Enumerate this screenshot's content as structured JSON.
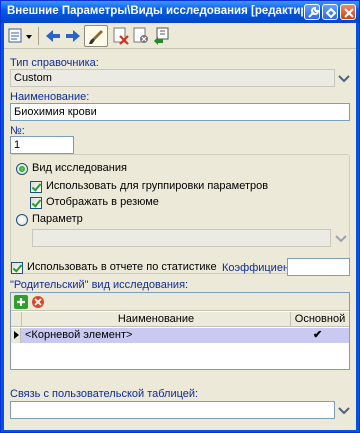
{
  "window": {
    "title": "Внешние Параметры\\Виды исследования [редактирование запис"
  },
  "toolbar": {
    "items": [
      "properties-icon",
      "arrow-left-icon",
      "arrow-right-icon",
      "brush-icon",
      "delete-icon",
      "clear-icon",
      "return-icon"
    ]
  },
  "reference_type": {
    "label": "Тип справочника:",
    "value": "Custom"
  },
  "name": {
    "label": "Наименование:",
    "value": "Биохимия крови"
  },
  "number": {
    "label": "№:",
    "value": "1"
  },
  "kind": {
    "investigation_label": "Вид исследования",
    "investigation_selected": true,
    "use_for_grouping_label": "Использовать для группировки параметров",
    "use_for_grouping_checked": true,
    "show_in_summary_label": "Отображать в резюме",
    "show_in_summary_checked": true,
    "parameter_label": "Параметр",
    "parameter_selected": false,
    "parameter_value": ""
  },
  "statistics": {
    "use_label": "Использовать в отчете по статистике",
    "use_checked": true,
    "coefficient_label": "Коэффициент:",
    "coefficient_value": ""
  },
  "parent": {
    "label": "\"Родительский\" вид исследования:",
    "columns": [
      "Наименование",
      "Основной"
    ],
    "rows": [
      {
        "name": "<Корневой элемент>",
        "main": "✔"
      }
    ]
  },
  "user_table": {
    "label": "Связь с пользовательской таблицей:",
    "value": ""
  },
  "colors": {
    "titlebar": "#0058e6",
    "label": "#0d2c9c",
    "selected_row": "#c9c9f2",
    "face": "#ece9d8"
  }
}
